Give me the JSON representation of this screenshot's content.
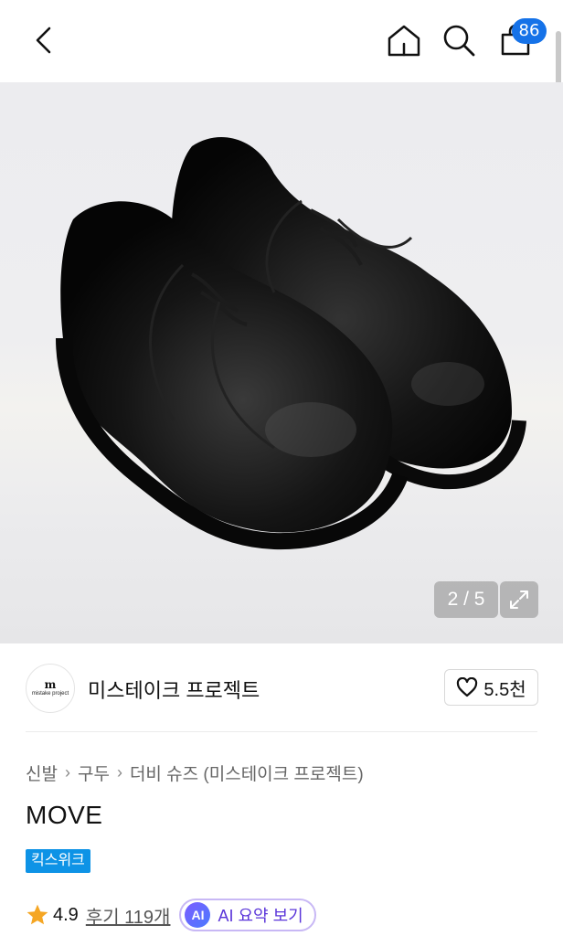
{
  "header": {
    "back_icon": "chevron-left-icon",
    "home_icon": "home-icon",
    "search_icon": "search-icon",
    "cart_icon": "bag-icon",
    "cart_count": "86",
    "badge_color": "#1572e8"
  },
  "gallery": {
    "counter": "2 / 5",
    "expand_icon": "expand-icon"
  },
  "brand": {
    "logo_mark": "m",
    "logo_text": "mistake project",
    "name": "미스테이크 프로젝트",
    "like_icon": "heart-icon",
    "like_count": "5.5천"
  },
  "breadcrumb": {
    "items": [
      "신발",
      "구두",
      "더비 슈즈 (미스테이크 프로젝트)"
    ]
  },
  "product": {
    "title": "MOVE",
    "tag": "킥스위크",
    "tag_color": "#0e93e6"
  },
  "rating": {
    "star_icon": "star-icon",
    "score": "4.9",
    "reviews": "후기 119개",
    "ai_badge": "AI",
    "ai_label": "AI 요약 보기"
  }
}
